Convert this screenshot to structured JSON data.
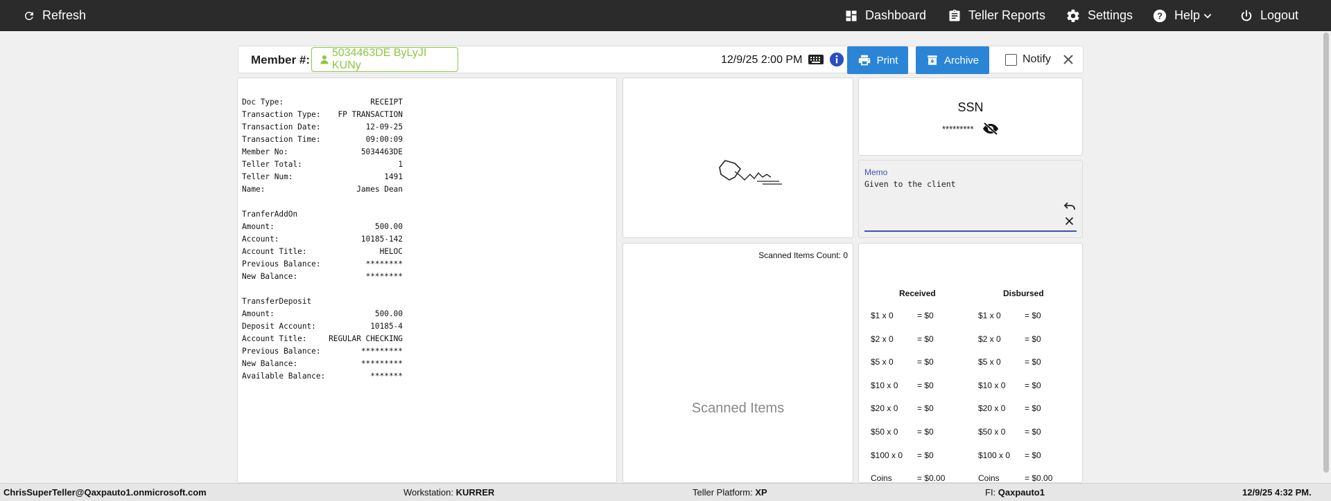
{
  "nav": {
    "refresh": "Refresh",
    "dashboard": "Dashboard",
    "teller_reports": "Teller Reports",
    "settings": "Settings",
    "help": "Help",
    "logout": "Logout"
  },
  "member": {
    "label": "Member #:",
    "chip": "5034463DE ByLyJI KUNy",
    "datetime": "12/9/25 2:00 PM",
    "print": "Print",
    "archive": "Archive",
    "notify": "Notify"
  },
  "receipt": {
    "sections": [
      [
        {
          "label": "Doc Type:",
          "value": "RECEIPT"
        },
        {
          "label": "Transaction Type:",
          "value": "FP TRANSACTION"
        },
        {
          "label": "Transaction Date:",
          "value": "12-09-25"
        },
        {
          "label": "Transaction Time:",
          "value": "09:00:09"
        },
        {
          "label": "Member No:",
          "value": "5034463DE"
        },
        {
          "label": "Teller Total:",
          "value": "1"
        },
        {
          "label": "Teller Num:",
          "value": "1491"
        },
        {
          "label": "Name:",
          "value": "James Dean"
        }
      ],
      [
        {
          "label": "TranferAddOn",
          "value": ""
        },
        {
          "label": "Amount:",
          "value": "500.00"
        },
        {
          "label": "Account:",
          "value": "10185-142"
        },
        {
          "label": "Account Title:",
          "value": "HELOC"
        },
        {
          "label": "Previous Balance:",
          "value": "********"
        },
        {
          "label": "New Balance:",
          "value": "********"
        }
      ],
      [
        {
          "label": "TransferDeposit",
          "value": ""
        },
        {
          "label": "Amount:",
          "value": "500.00"
        },
        {
          "label": "Deposit Account:",
          "value": "10185-4"
        },
        {
          "label": "Account Title:",
          "value": "REGULAR CHECKING"
        },
        {
          "label": "Previous Balance:",
          "value": "*********"
        },
        {
          "label": "New Balance:",
          "value": "*********"
        },
        {
          "label": "Available Balance:",
          "value": "*******"
        }
      ]
    ]
  },
  "ssn": {
    "title": "SSN",
    "value": "*********"
  },
  "memo": {
    "label": "Memo",
    "value": "Given to the client"
  },
  "scanned": {
    "count_label": "Scanned Items Count: 0",
    "placeholder": "Scanned Items"
  },
  "cash": {
    "received_header": "Received",
    "disbursed_header": "Disbursed",
    "rows": [
      {
        "recv_denom": "$1 x 0",
        "recv_total": "= $0",
        "disb_denom": "$1 x 0",
        "disb_total": "= $0"
      },
      {
        "recv_denom": "$2 x 0",
        "recv_total": "= $0",
        "disb_denom": "$2 x 0",
        "disb_total": "= $0"
      },
      {
        "recv_denom": "$5 x 0",
        "recv_total": "= $0",
        "disb_denom": "$5 x 0",
        "disb_total": "= $0"
      },
      {
        "recv_denom": "$10 x 0",
        "recv_total": "= $0",
        "disb_denom": "$10 x 0",
        "disb_total": "= $0"
      },
      {
        "recv_denom": "$20 x 0",
        "recv_total": "= $0",
        "disb_denom": "$20 x 0",
        "disb_total": "= $0"
      },
      {
        "recv_denom": "$50 x 0",
        "recv_total": "= $0",
        "disb_denom": "$50 x 0",
        "disb_total": "= $0"
      },
      {
        "recv_denom": "$100 x 0",
        "recv_total": "= $0",
        "disb_denom": "$100 x 0",
        "disb_total": "= $0"
      },
      {
        "recv_denom": "Coins",
        "recv_total": "= $0.00",
        "disb_denom": "Coins",
        "disb_total": "= $0.00"
      }
    ]
  },
  "status": {
    "user": "ChrisSuperTeller@Qaxpauto1.onmicrosoft.com",
    "workstation_label": "Workstation:",
    "workstation": "KURRER",
    "platform_label": "Teller Platform:",
    "platform": "XP",
    "fi_label": "FI:",
    "fi": "Qaxpauto1",
    "time": "12/9/25 4:32 PM."
  },
  "colors": {
    "navbar": "#2b2b2b",
    "accent_blue": "#2b85d6",
    "member_green": "#8cc63f",
    "memo_underline": "#3f51b5"
  }
}
